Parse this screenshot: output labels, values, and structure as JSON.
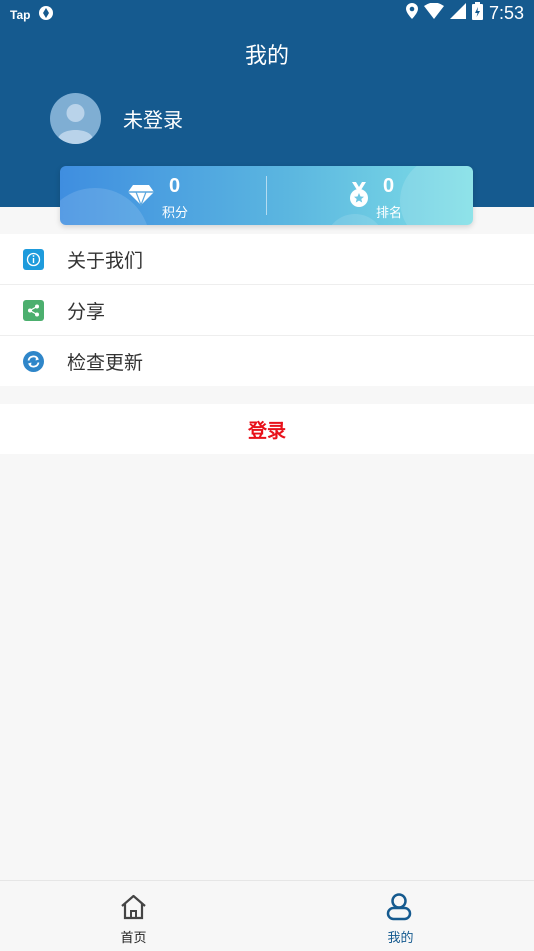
{
  "status_bar": {
    "app_label": "Tap",
    "time": "7:53"
  },
  "header": {
    "title": "我的"
  },
  "profile": {
    "username": "未登录"
  },
  "stats": [
    {
      "value": "0",
      "label": "积分",
      "icon": "diamond-icon"
    },
    {
      "value": "0",
      "label": "排名",
      "icon": "medal-icon"
    }
  ],
  "menu": [
    {
      "label": "关于我们",
      "icon": "info-icon",
      "color": "#1e9bdc"
    },
    {
      "label": "分享",
      "icon": "share-icon",
      "color": "#4caf6e"
    },
    {
      "label": "检查更新",
      "icon": "refresh-icon",
      "color": "#2f86c9"
    }
  ],
  "login": {
    "label": "登录",
    "color": "#e8111a"
  },
  "bottom_nav": [
    {
      "label": "首页",
      "icon": "home-icon",
      "active": false
    },
    {
      "label": "我的",
      "icon": "user-icon",
      "active": true
    }
  ],
  "colors": {
    "primary": "#155a8f",
    "background": "#f7f7f7"
  }
}
